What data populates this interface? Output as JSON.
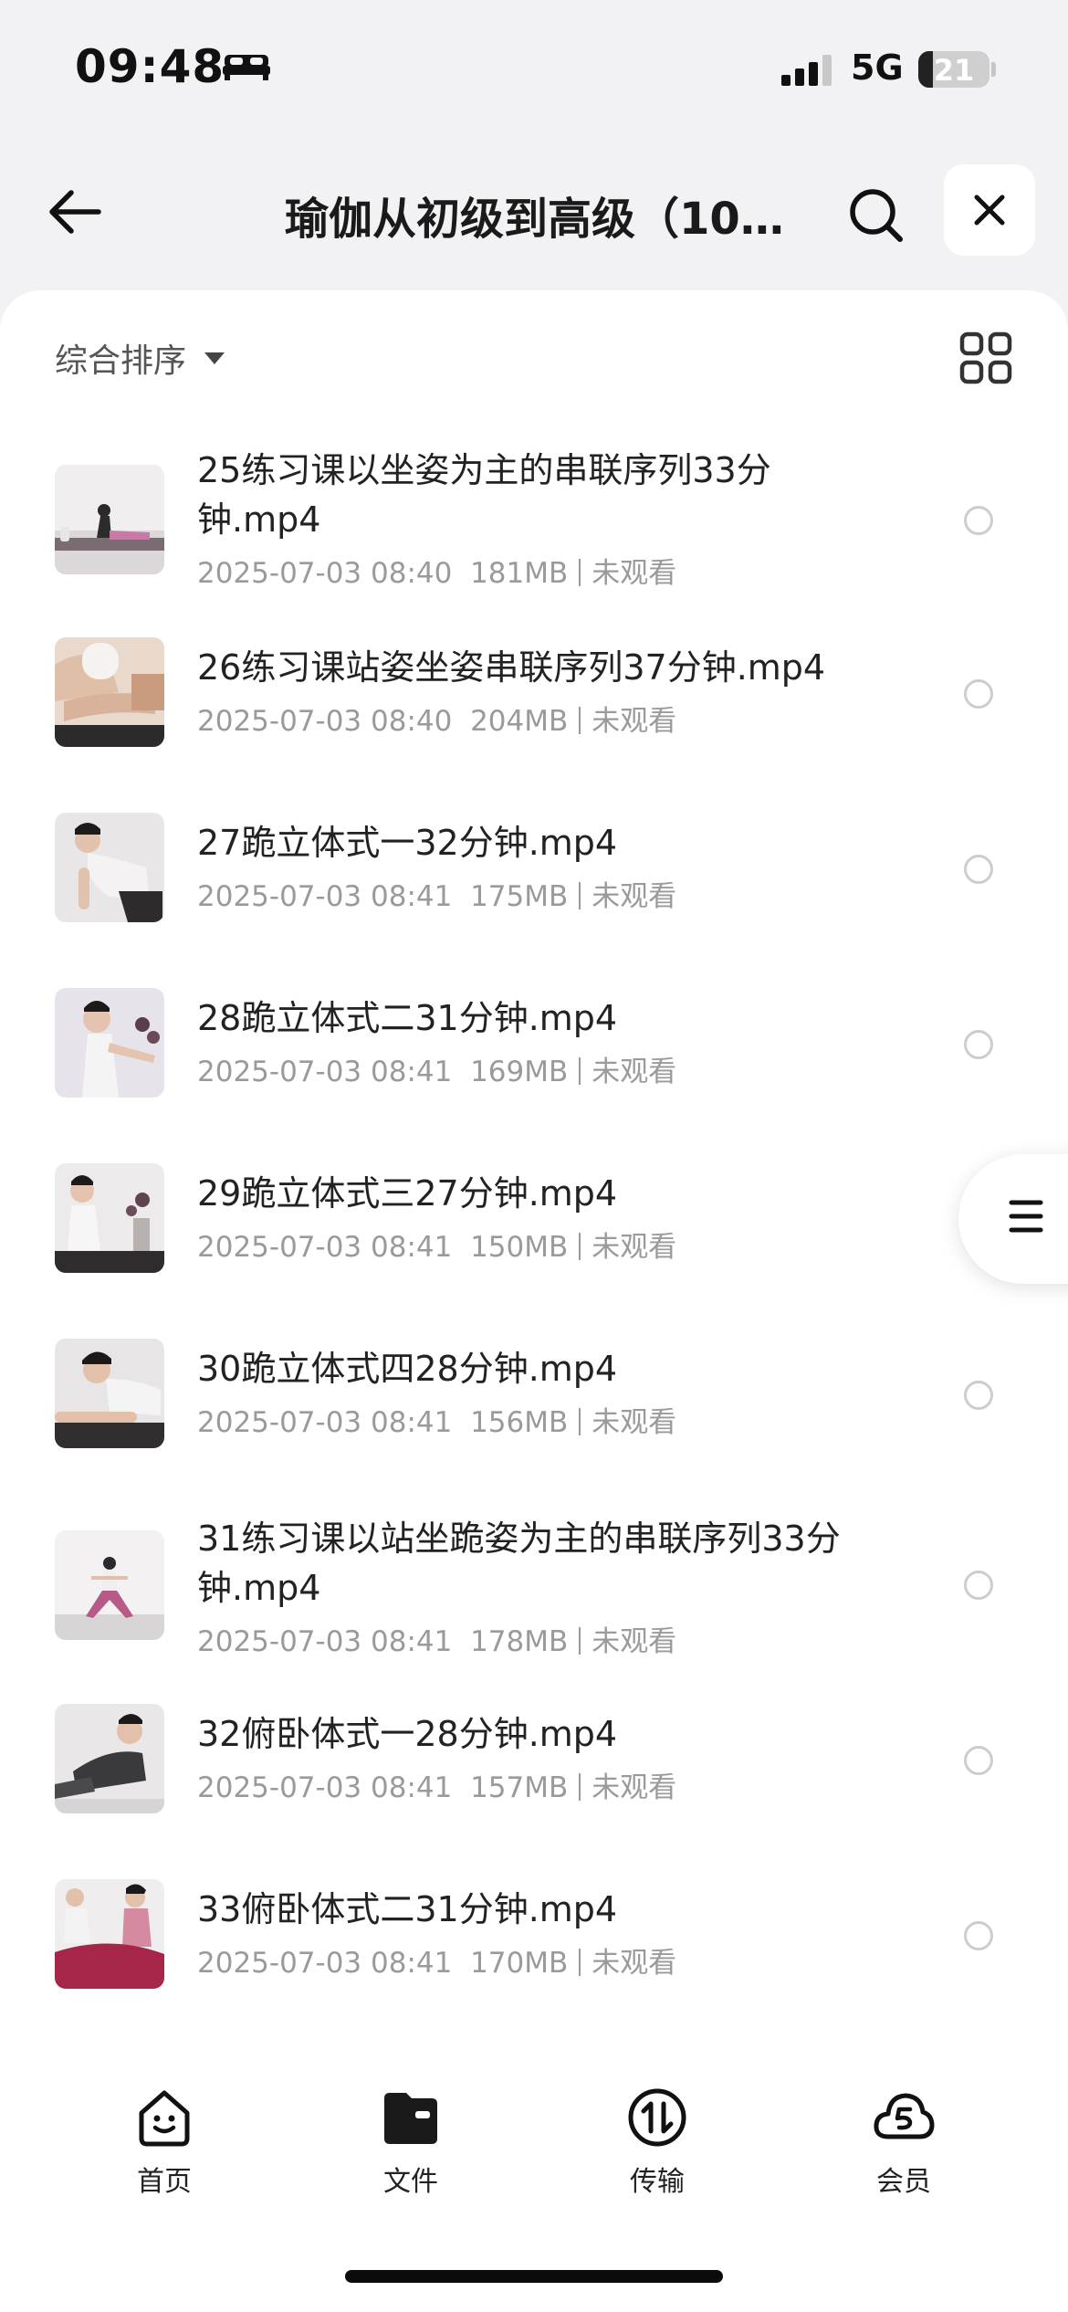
{
  "status_bar": {
    "time": "09:48",
    "network": "5G",
    "battery": "21",
    "battery_level": 0.21
  },
  "header": {
    "title": "瑜伽从初级到高级（10..."
  },
  "toolbar": {
    "sort_label": "综合排序"
  },
  "files": [
    {
      "name": "25练习课以坐姿为主的串联序列33分钟.mp4",
      "date": "2025-07-03 08:40",
      "size": "181MB",
      "status": "未观看"
    },
    {
      "name": "26练习课站姿坐姿串联序列37分钟.mp4",
      "date": "2025-07-03 08:40",
      "size": "204MB",
      "status": "未观看"
    },
    {
      "name": "27跪立体式一32分钟.mp4",
      "date": "2025-07-03 08:41",
      "size": "175MB",
      "status": "未观看"
    },
    {
      "name": "28跪立体式二31分钟.mp4",
      "date": "2025-07-03 08:41",
      "size": "169MB",
      "status": "未观看"
    },
    {
      "name": "29跪立体式三27分钟.mp4",
      "date": "2025-07-03 08:41",
      "size": "150MB",
      "status": "未观看"
    },
    {
      "name": "30跪立体式四28分钟.mp4",
      "date": "2025-07-03 08:41",
      "size": "156MB",
      "status": "未观看"
    },
    {
      "name": "31练习课以站坐跪姿为主的串联序列33分钟.mp4",
      "date": "2025-07-03 08:41",
      "size": "178MB",
      "status": "未观看"
    },
    {
      "name": "32俯卧体式一28分钟.mp4",
      "date": "2025-07-03 08:41",
      "size": "157MB",
      "status": "未观看"
    },
    {
      "name": "33俯卧体式二31分钟.mp4",
      "date": "2025-07-03 08:41",
      "size": "170MB",
      "status": "未观看"
    }
  ],
  "bottom_nav": [
    {
      "label": "首页",
      "icon": "smile-face-icon"
    },
    {
      "label": "文件",
      "icon": "folder-icon"
    },
    {
      "label": "传输",
      "icon": "transfer-icon"
    },
    {
      "label": "会员",
      "icon": "cloud-s-icon"
    }
  ]
}
